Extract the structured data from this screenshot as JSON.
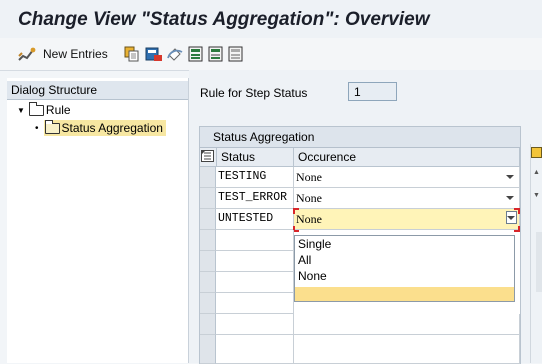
{
  "title": "Change View \"Status Aggregation\": Overview",
  "toolbar": {
    "new_entries_label": "New Entries"
  },
  "dialog_structure": {
    "header": "Dialog Structure",
    "rule_label": "Rule",
    "status_aggregation_label": "Status Aggregation"
  },
  "rule_field": {
    "label": "Rule for Step Status",
    "value": "1"
  },
  "table": {
    "title": "Status Aggregation",
    "columns": [
      "Status",
      "Occurence"
    ],
    "rows": [
      {
        "status": "TESTING",
        "occurence": "None"
      },
      {
        "status": "TEST_ERROR",
        "occurence": "None"
      },
      {
        "status": "UNTESTED",
        "occurence": "None"
      }
    ]
  },
  "dropdown": {
    "options": [
      "Single",
      "All",
      "None",
      ""
    ]
  },
  "colors": {
    "highlight": "#f7e7a2",
    "active_cell": "#fff4b8",
    "selection_corner": "#d8262a"
  }
}
